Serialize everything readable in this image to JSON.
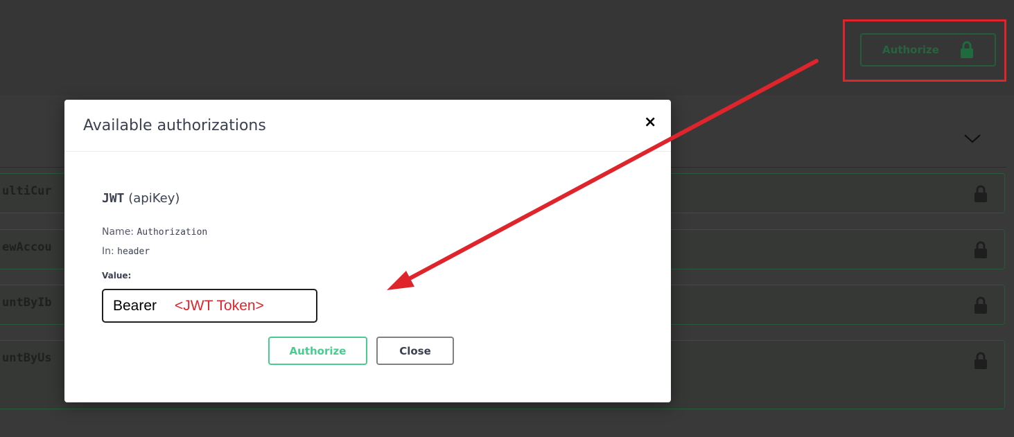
{
  "top_bar": {
    "authorize_label": "Authorize"
  },
  "operations": [
    {
      "path": "ultiCur"
    },
    {
      "path": "ewAccou"
    },
    {
      "path": "untByIb"
    },
    {
      "path": "untByUs"
    }
  ],
  "modal": {
    "title": "Available authorizations",
    "close_glyph": "×",
    "scheme_name": "JWT",
    "scheme_type": "(apiKey)",
    "name_label": "Name:",
    "name_value": "Authorization",
    "in_label": "In:",
    "in_value": "header",
    "value_label": "Value:",
    "value_prefix": "Bearer",
    "value_token": "<JWT Token>",
    "authorize_button": "Authorize",
    "close_button": "Close"
  },
  "colors": {
    "authorize_green": "#49cc90",
    "annotation_red": "#e0242c",
    "dim_green": "#28633f"
  },
  "icons": [
    "lock-icon",
    "chevron-down-icon",
    "close-icon"
  ]
}
